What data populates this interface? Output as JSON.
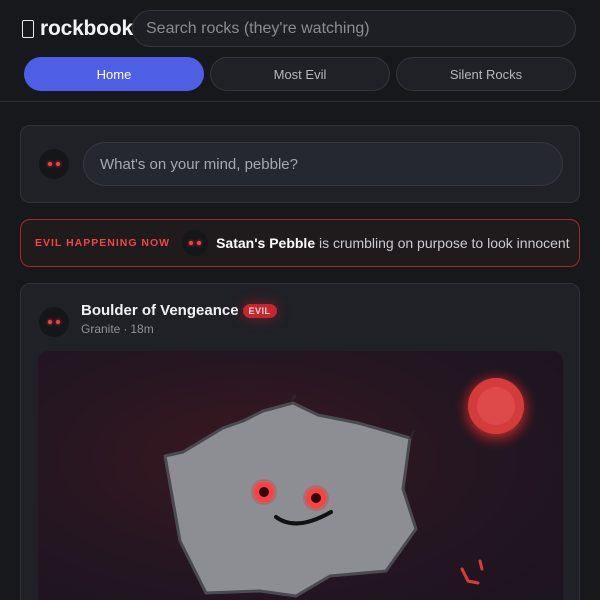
{
  "brand": {
    "icon": "rock-glyph-icon",
    "name": "rockbook"
  },
  "search": {
    "placeholder": "Search rocks (they're watching)",
    "value": ""
  },
  "tabs": [
    {
      "label": "Home",
      "active": true
    },
    {
      "label": "Most Evil",
      "active": false
    },
    {
      "label": "Silent Rocks",
      "active": false
    }
  ],
  "composer": {
    "placeholder": "What's on your mind, pebble?"
  },
  "alert": {
    "label": "EVIL HAPPENING NOW",
    "subject": "Satan's Pebble",
    "message": " is crumbling on purpose to look innocent"
  },
  "post": {
    "author": "Boulder of Vengeance",
    "badge": "EVIL",
    "rock_type": "Granite",
    "separator": "·",
    "time": "18m"
  },
  "colors": {
    "accent": "#4e5fe6",
    "evil_red": "#f0463f",
    "background": "#17181c"
  }
}
